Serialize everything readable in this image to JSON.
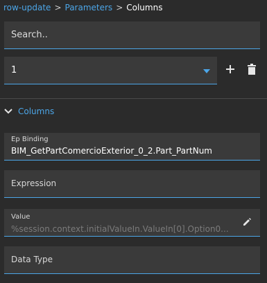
{
  "breadcrumb": {
    "items": [
      {
        "label": "row-update"
      },
      {
        "label": "Parameters"
      },
      {
        "label": "Columns"
      }
    ],
    "separator": ">"
  },
  "search": {
    "placeholder": "Search.."
  },
  "selector": {
    "value": "1"
  },
  "toolbar": {
    "add_icon": "plus-icon",
    "delete_icon": "trash-icon"
  },
  "section": {
    "title": "Columns",
    "icon": "chevron-down-icon"
  },
  "fields": {
    "ep_binding": {
      "label": "Ep Binding",
      "value": "BIM_GetPartComercioExterior_0_2.Part_PartNum"
    },
    "expression": {
      "placeholder": "Expression"
    },
    "value": {
      "label": "Value",
      "ghost": "%session.context.initialValueIn.ValueIn[0].Option0...",
      "edit_icon": "pencil-icon"
    },
    "data_type": {
      "placeholder": "Data Type"
    }
  },
  "colors": {
    "background": "#2b2b2b",
    "field_background": "#3a3a3a",
    "accent": "#4ca6e8"
  }
}
